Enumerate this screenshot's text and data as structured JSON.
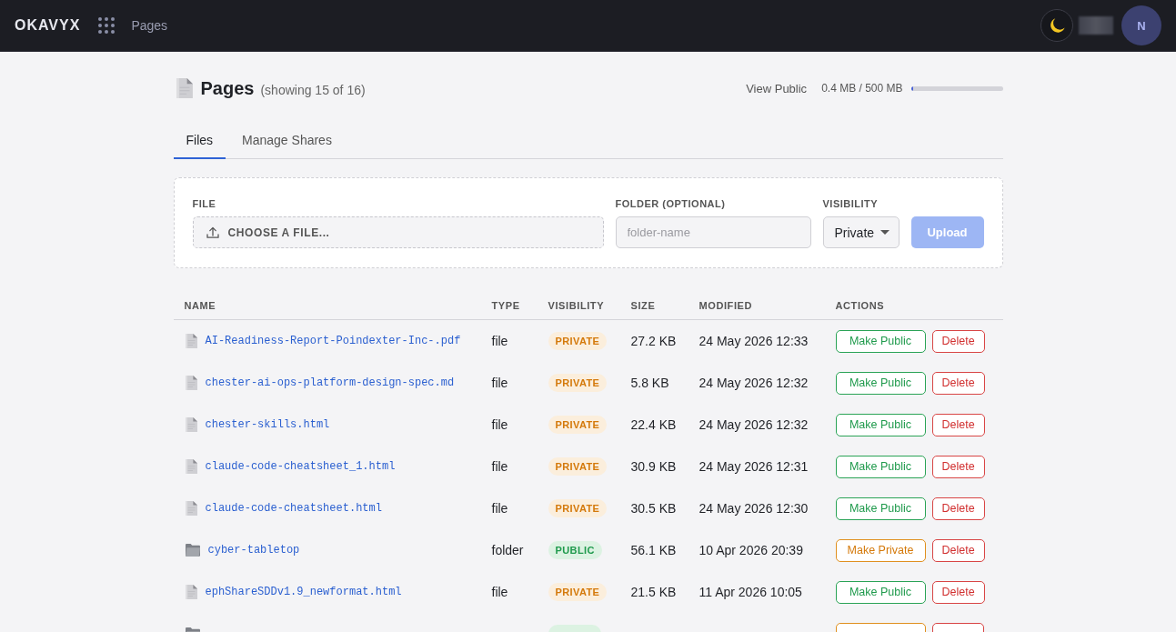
{
  "top_bar": {
    "logo": "OKAVYX",
    "section": "Pages",
    "avatar_initial": "N"
  },
  "header": {
    "title": "Pages",
    "count": "(showing 15 of 16)",
    "view_public": "View Public",
    "storage": {
      "reading": "0.4 MB / 500 MB",
      "level": 0.0008
    }
  },
  "tabs": [
    {
      "label": "Files",
      "selected": true
    },
    {
      "label": "Manage Shares",
      "selected": false
    }
  ],
  "upload_form": {
    "file": {
      "label": "FILE",
      "button": "CHOOSE A FILE..."
    },
    "folder": {
      "label": "FOLDER (OPTIONAL)",
      "placeholder": "folder-name"
    },
    "visibility": {
      "label": "VISIBILITY",
      "value": "Private"
    },
    "upload_button": {
      "label": "Upload",
      "disabled": true
    }
  },
  "table": {
    "columns": [
      "NAME",
      "TYPE",
      "VISIBILITY",
      "SIZE",
      "MODIFIED",
      "ACTIONS"
    ],
    "rows": [
      {
        "kind": "file",
        "name": "AI-Readiness-Report-Poindexter-Inc-.pdf",
        "type": "file",
        "visibility": {
          "label": "PRIVATE",
          "public": false
        },
        "size": "27.2 KB",
        "modified": "24 May 2026 12:33",
        "actions": [
          {
            "label": "Make Public",
            "kind": "make-public"
          },
          {
            "label": "Delete",
            "kind": "delete"
          }
        ]
      },
      {
        "kind": "file",
        "name": "chester-ai-ops-platform-design-spec.md",
        "type": "file",
        "visibility": {
          "label": "PRIVATE",
          "public": false
        },
        "size": "5.8 KB",
        "modified": "24 May 2026 12:32",
        "actions": [
          {
            "label": "Make Public",
            "kind": "make-public"
          },
          {
            "label": "Delete",
            "kind": "delete"
          }
        ]
      },
      {
        "kind": "file",
        "name": "chester-skills.html",
        "type": "file",
        "visibility": {
          "label": "PRIVATE",
          "public": false
        },
        "size": "22.4 KB",
        "modified": "24 May 2026 12:32",
        "actions": [
          {
            "label": "Make Public",
            "kind": "make-public"
          },
          {
            "label": "Delete",
            "kind": "delete"
          }
        ]
      },
      {
        "kind": "file",
        "name": "claude-code-cheatsheet_1.html",
        "type": "file",
        "visibility": {
          "label": "PRIVATE",
          "public": false
        },
        "size": "30.9 KB",
        "modified": "24 May 2026 12:31",
        "actions": [
          {
            "label": "Make Public",
            "kind": "make-public"
          },
          {
            "label": "Delete",
            "kind": "delete"
          }
        ]
      },
      {
        "kind": "file",
        "name": "claude-code-cheatsheet.html",
        "type": "file",
        "visibility": {
          "label": "PRIVATE",
          "public": false
        },
        "size": "30.5 KB",
        "modified": "24 May 2026 12:30",
        "actions": [
          {
            "label": "Make Public",
            "kind": "make-public"
          },
          {
            "label": "Delete",
            "kind": "delete"
          }
        ]
      },
      {
        "kind": "folder",
        "name": "cyber-tabletop",
        "type": "folder",
        "visibility": {
          "label": "PUBLIC",
          "public": true
        },
        "size": "56.1 KB",
        "modified": "10 Apr 2026 20:39",
        "actions": [
          {
            "label": "Make Private",
            "kind": "make-private"
          },
          {
            "label": "Delete",
            "kind": "delete"
          }
        ]
      },
      {
        "kind": "file",
        "name": "ephShareSDDv1.9_newformat.html",
        "type": "file",
        "visibility": {
          "label": "PRIVATE",
          "public": false
        },
        "size": "21.5 KB",
        "modified": "11 Apr 2026 10:05",
        "actions": [
          {
            "label": "Make Public",
            "kind": "make-public"
          },
          {
            "label": "Delete",
            "kind": "delete"
          }
        ]
      },
      {
        "kind": "folder",
        "visibility": {
          "public": true
        },
        "actions": [
          {
            "kind": "make-private"
          },
          {
            "kind": "delete"
          }
        ]
      }
    ]
  }
}
